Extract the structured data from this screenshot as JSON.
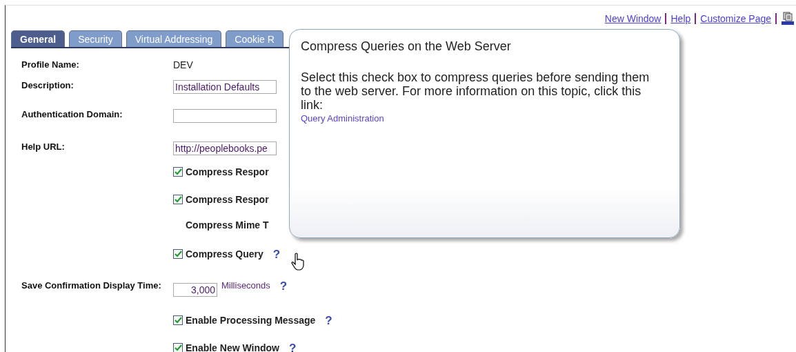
{
  "top_links": [
    "New Window",
    "Help",
    "Customize Page"
  ],
  "tabs": [
    {
      "label": "General",
      "selected": true
    },
    {
      "label": "Security",
      "selected": false
    },
    {
      "label": "Virtual Addressing",
      "selected": false
    },
    {
      "label": "Cookie R",
      "selected": false
    }
  ],
  "rows": [
    {
      "kind": "text",
      "label": "Profile Name:",
      "value": "DEV"
    },
    {
      "kind": "input",
      "label": "Description:",
      "value": "Installation Defaults"
    },
    {
      "kind": "input",
      "label": "Authentication Domain:"
    },
    {
      "kind": "input",
      "label": "Help URL:",
      "value": "http://peoplebooks.pe"
    },
    {
      "kind": "checkbox",
      "text": "Compress Respor",
      "checked": true
    },
    {
      "kind": "checkbox",
      "text": "Compress Respor",
      "checked": true
    },
    {
      "kind": "caption",
      "text": "Compress Mime T"
    },
    {
      "kind": "checkbox",
      "text": "Compress Query",
      "checked": true,
      "help": "?"
    },
    {
      "kind": "number",
      "label": "Save Confirmation Display Time:",
      "value": "3,000",
      "unit": "Milliseconds",
      "help": "?"
    },
    {
      "kind": "checkbox",
      "text": "Enable Processing Message",
      "checked": true,
      "help": "?"
    },
    {
      "kind": "checkbox",
      "text": "Enable New Window",
      "checked": true,
      "help": "?"
    }
  ],
  "popup": {
    "title": "Compress Queries on the Web Server",
    "body": "Select this check box to compress queries before sending them to the web server. For more information on this topic, click this link:",
    "link": "Query Administration"
  }
}
